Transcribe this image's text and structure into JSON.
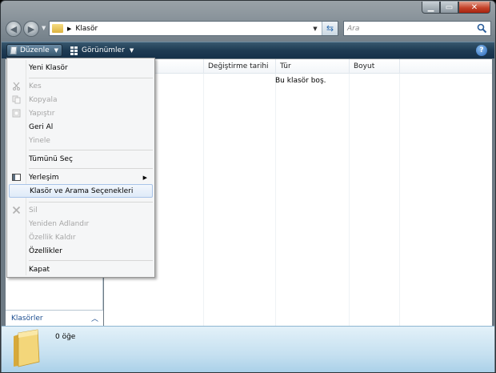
{
  "window": {
    "address_path": "Klasör",
    "search_placeholder": "Ara"
  },
  "toolbar": {
    "organize_label": "Düzenle",
    "views_label": "Görünümler",
    "help_label": "?"
  },
  "columns": [
    "Değiştirme tarihi",
    "Tür",
    "Boyut"
  ],
  "file_list": {
    "empty_message": "Bu klasör boş."
  },
  "left_pane": {
    "folders_label": "Klasörler"
  },
  "details": {
    "item_count": "0 öğe"
  },
  "organize_menu": {
    "items": [
      {
        "label": "Yeni Klasör",
        "enabled": true
      },
      {
        "label": "Kes",
        "enabled": false,
        "icon": "scissors-icon"
      },
      {
        "label": "Kopyala",
        "enabled": false,
        "icon": "copy-icon"
      },
      {
        "label": "Yapıştır",
        "enabled": false,
        "icon": "paste-icon"
      },
      {
        "label": "Geri Al",
        "enabled": true
      },
      {
        "label": "Yinele",
        "enabled": false
      },
      {
        "label": "Tümünü Seç",
        "enabled": true
      },
      {
        "label": "Yerleşim",
        "enabled": true,
        "icon": "layout-icon",
        "submenu": true
      },
      {
        "label": "Klasör ve Arama Seçenekleri",
        "enabled": true,
        "highlighted": true
      },
      {
        "label": "Sil",
        "enabled": false,
        "icon": "delete-icon"
      },
      {
        "label": "Yeniden Adlandır",
        "enabled": false
      },
      {
        "label": "Özellik Kaldır",
        "enabled": false
      },
      {
        "label": "Özellikler",
        "enabled": true
      },
      {
        "label": "Kapat",
        "enabled": true
      }
    ]
  },
  "colors": {
    "command_bar": "#1e3b53",
    "menu_highlight": "#dfeaf8",
    "link_blue": "#1b4d8f",
    "details_pane": "#c5e0f0"
  }
}
